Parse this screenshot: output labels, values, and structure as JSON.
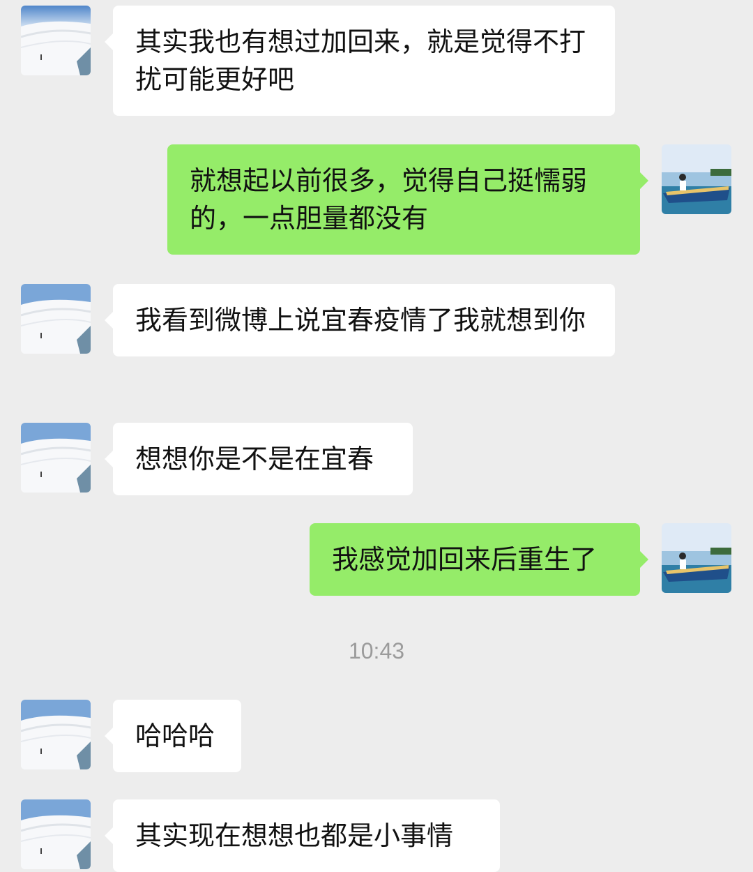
{
  "contact": {
    "avatar_icon": "white-architecture-avatar",
    "bubble_color": "#ffffff"
  },
  "me": {
    "avatar_icon": "boat-photo-avatar",
    "bubble_color": "#95ec69"
  },
  "messages": [
    {
      "sender": "contact",
      "text": "其实我也有想过加回来，就是觉得不打扰可能更好吧"
    },
    {
      "sender": "me",
      "text": "就想起以前很多，觉得自己挺懦弱的，一点胆量都没有"
    },
    {
      "sender": "contact",
      "text": "我看到微博上说宜春疫情了我就想到你"
    },
    {
      "sender": "contact",
      "text": "想想你是不是在宜春"
    },
    {
      "sender": "me",
      "text": "我感觉加回来后重生了"
    },
    {
      "sender": "contact",
      "text": "哈哈哈"
    },
    {
      "sender": "contact",
      "text": "其实现在想想也都是小事情"
    }
  ],
  "timestamp": "10:43"
}
